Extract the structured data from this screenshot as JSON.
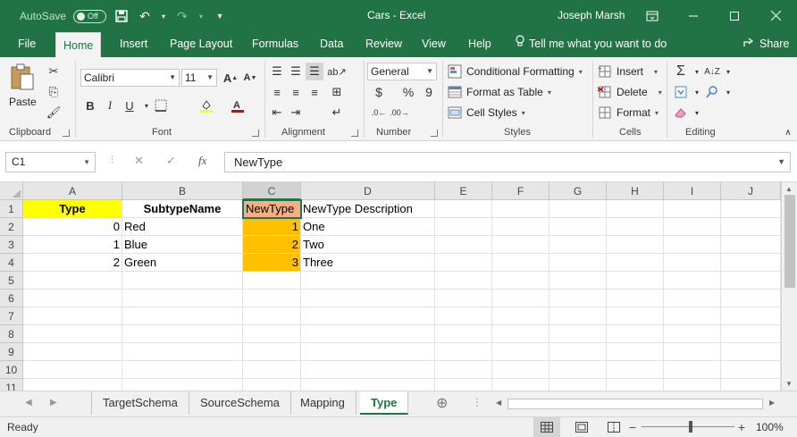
{
  "titlebar": {
    "autosave_label": "AutoSave",
    "autosave_state": "Off",
    "title": "Cars  -  Excel",
    "user": "Joseph Marsh"
  },
  "tabs": [
    "File",
    "Home",
    "Insert",
    "Page Layout",
    "Formulas",
    "Data",
    "Review",
    "View",
    "Help"
  ],
  "active_tab": "Home",
  "tell_me": "Tell me what you want to do",
  "share": "Share",
  "ribbon": {
    "clipboard": {
      "paste": "Paste",
      "label": "Clipboard"
    },
    "font": {
      "name": "Calibri",
      "size": "11",
      "label": "Font",
      "bold": "B",
      "italic": "I",
      "underline": "U"
    },
    "alignment": {
      "label": "Alignment"
    },
    "number": {
      "format": "General",
      "label": "Number",
      "currency": "$",
      "percent": "%",
      "comma": "9"
    },
    "styles": {
      "conditional": "Conditional Formatting",
      "format_table": "Format as Table",
      "cell_styles": "Cell Styles",
      "label": "Styles"
    },
    "cells": {
      "insert": "Insert",
      "delete": "Delete",
      "format": "Format",
      "label": "Cells"
    },
    "editing": {
      "label": "Editing"
    }
  },
  "formula_bar": {
    "name_box": "C1",
    "fx": "fx",
    "content": "NewType"
  },
  "columns": [
    "A",
    "B",
    "C",
    "D",
    "E",
    "F",
    "G",
    "H",
    "I",
    "J"
  ],
  "selected_column": "C",
  "rows": [
    "1",
    "2",
    "3",
    "4",
    "5",
    "6",
    "7",
    "8",
    "9",
    "10",
    "11"
  ],
  "cells": {
    "A1": "Type",
    "B1": "SubtypeName",
    "C1": "NewType",
    "D1": "NewType Description",
    "A2": "0",
    "B2": "Red",
    "C2": "1",
    "D2": "One",
    "A3": "1",
    "B3": "Blue",
    "C3": "2",
    "D3": "Two",
    "A4": "2",
    "B4": "Green",
    "C4": "3",
    "D4": "Three"
  },
  "sheets": [
    "TargetSchema",
    "SourceSchema",
    "Mapping",
    "Type"
  ],
  "active_sheet": "Type",
  "status": {
    "ready": "Ready",
    "zoom": "100%",
    "zoom_minus": "−",
    "zoom_plus": "+"
  },
  "colors": {
    "excel_green": "#217346",
    "header_yellow": "#ffff00",
    "header_orange": "#f4b084",
    "column_orange": "#ffc000"
  }
}
